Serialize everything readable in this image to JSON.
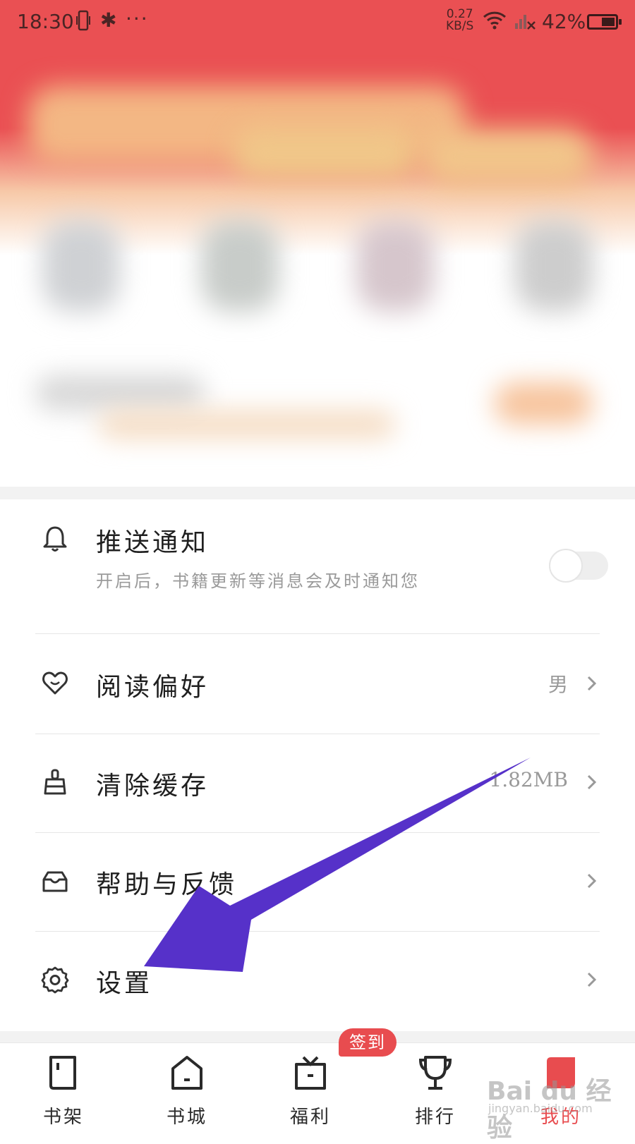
{
  "status_bar": {
    "time": "18:30",
    "net_speed_value": "0.27",
    "net_speed_unit": "KB/S",
    "battery_pct": "42%",
    "icons": [
      "vibrate-icon",
      "bluetooth-icon",
      "more-dots-icon",
      "wifi-icon",
      "signal-icon",
      "battery-icon"
    ]
  },
  "settings": {
    "push": {
      "title": "推送通知",
      "subtitle": "开启后，书籍更新等消息会及时通知您",
      "enabled": false,
      "icon": "bell-icon"
    },
    "reading": {
      "title": "阅读偏好",
      "value": "男",
      "icon": "heart-icon"
    },
    "cache": {
      "title": "清除缓存",
      "value": "1.82MB",
      "icon": "brush-icon"
    },
    "help": {
      "title": "帮助与反馈",
      "icon": "inbox-icon"
    },
    "settings": {
      "title": "设置",
      "icon": "gear-icon"
    }
  },
  "tabs": [
    {
      "label": "书架",
      "icon": "bookshelf-icon",
      "active": false
    },
    {
      "label": "书城",
      "icon": "store-icon",
      "active": false
    },
    {
      "label": "福利",
      "icon": "gift-icon",
      "active": false
    },
    {
      "label": "排行",
      "icon": "trophy-icon",
      "active": false
    },
    {
      "label": "我的",
      "icon": "profile-icon",
      "active": true
    }
  ],
  "checkin_badge": "签到",
  "watermark": {
    "main": "Bai du 经验",
    "sub": "jingyan.baidu.com"
  },
  "colors": {
    "accent": "#e84c4f",
    "arrow": "#5631c9",
    "statusbar": "#ea5053"
  }
}
